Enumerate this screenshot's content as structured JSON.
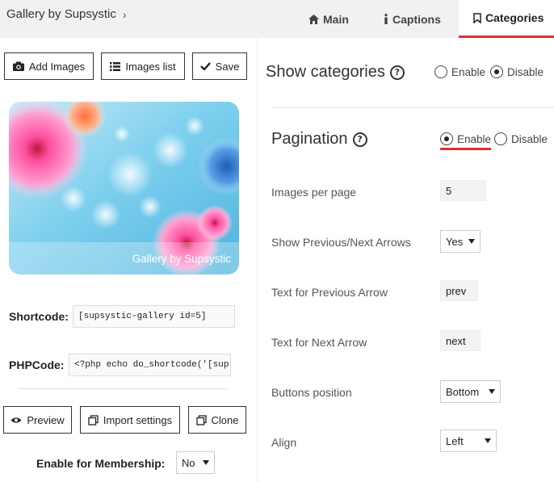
{
  "header": {
    "breadcrumb": "Gallery by Supsystic",
    "tabs": [
      {
        "label": "Main",
        "icon": "home-icon"
      },
      {
        "label": "Captions",
        "icon": "info-icon"
      },
      {
        "label": "Categories",
        "icon": "bookmark-icon",
        "active": true
      }
    ]
  },
  "toolbar": {
    "add_images": "Add Images",
    "images_list": "Images list",
    "save": "Save"
  },
  "preview": {
    "caption": "Gallery by Supsystic"
  },
  "codes": {
    "shortcode_label": "Shortcode:",
    "shortcode_value": "[supsystic-gallery id=5]",
    "phpcode_label": "PHPCode:",
    "phpcode_value": "<?php echo do_shortcode('[sup"
  },
  "actions": {
    "preview": "Preview",
    "import_settings": "Import settings",
    "clone": "Clone"
  },
  "membership": {
    "label": "Enable for Membership:",
    "value": "No"
  },
  "categories": {
    "title": "Show categories",
    "enable": "Enable",
    "disable": "Disable",
    "selected": "Disable"
  },
  "pagination": {
    "title": "Pagination",
    "enable": "Enable",
    "disable": "Disable",
    "selected": "Enable",
    "rows": {
      "images_per_page": {
        "label": "Images per page",
        "value": "5"
      },
      "arrows": {
        "label": "Show Previous/Next Arrows",
        "value": "Yes"
      },
      "prev_text": {
        "label": "Text for Previous Arrow",
        "value": "prev"
      },
      "next_text": {
        "label": "Text for Next Arrow",
        "value": "next"
      },
      "buttons_position": {
        "label": "Buttons position",
        "value": "Bottom"
      },
      "align": {
        "label": "Align",
        "value": "Left"
      }
    }
  },
  "colors": {
    "accent": "#e22e2e",
    "topbar": "#f1f1f1"
  }
}
